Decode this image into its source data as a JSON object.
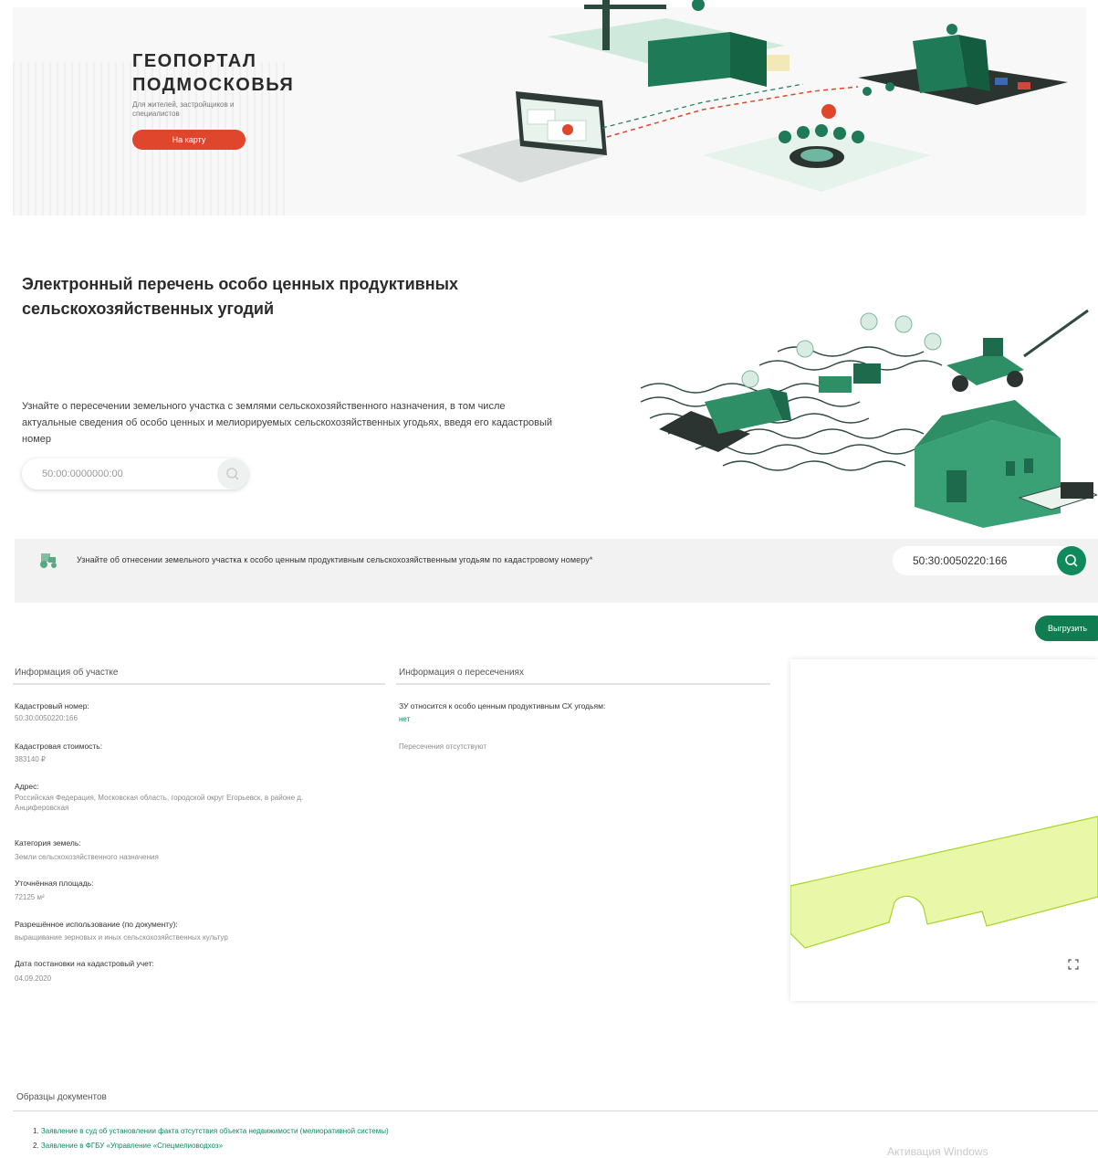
{
  "hero": {
    "title": "ГЕОПОРТАЛ\nПОДМОСКОВЬЯ",
    "subtitle": "Для жителей, застройщиков и\nспециалистов",
    "cta_label": "На карту"
  },
  "section": {
    "title": "Электронный перечень особо ценных продуктивных сельскохозяйственных угодий",
    "description": "Узнайте о пересечении земельного участка с землями сельскохозяйственного назначения, в том числе актуальные сведения об особо ценных и мелиорируемых сельскохозяйственных угодьях, введя его кадастровый номер",
    "search_placeholder": "50:00:0000000:00"
  },
  "query_bar": {
    "text": "Узнайте об отнесении земельного участка к особо ценным продуктивным сельскохозяйственным угодьям по кадастровому номеру*",
    "search_value": "50:30:0050220:166"
  },
  "export_label": "Выгрузить",
  "plot_info": {
    "heading": "Информация об участке",
    "fields": [
      {
        "label": "Кадастровый номер:",
        "value": "50:30:0050220:166"
      },
      {
        "label": "Кадастровая стоимость:",
        "value": "383140 ₽"
      },
      {
        "label": "Адрес:",
        "value": "Российская Федерация, Московская область, городской округ Егорьевск, в районе д. Анциферовская"
      },
      {
        "label": "Категория земель:",
        "value": "Земли сельскохозяйственного назначения"
      },
      {
        "label": "Уточнённая площадь:",
        "value": "72125 м²"
      },
      {
        "label": "Разрешённое использование (по документу):",
        "value": "выращивание зерновых и иных сельскохозяйственных культур"
      },
      {
        "label": "Дата постановки на кадастровый учет:",
        "value": "04.09.2020"
      }
    ]
  },
  "intersections": {
    "heading": "Информация о пересечениях",
    "label": "ЗУ относится к особо ценным продуктивным СХ угодьям:",
    "value": "нет",
    "note": "Пересечения отсутствуют"
  },
  "docs": {
    "heading": "Образцы документов",
    "items": [
      {
        "num": "1.",
        "text": "Заявление в суд об установлении факта отсутствия объекта недвижимости (мелиоративной системы)"
      },
      {
        "num": "2.",
        "text": "Заявление в ФГБУ «Управление «Спецмелиоводхоз»"
      }
    ]
  },
  "watermark": "Активация Windows",
  "colors": {
    "accent": "#0f8a5c",
    "cta": "#e0462b",
    "plot_fill": "#e9f8a8",
    "plot_stroke": "#a7d32a"
  },
  "icons": [
    "search-icon",
    "tractor-icon",
    "fullscreen-icon"
  ]
}
